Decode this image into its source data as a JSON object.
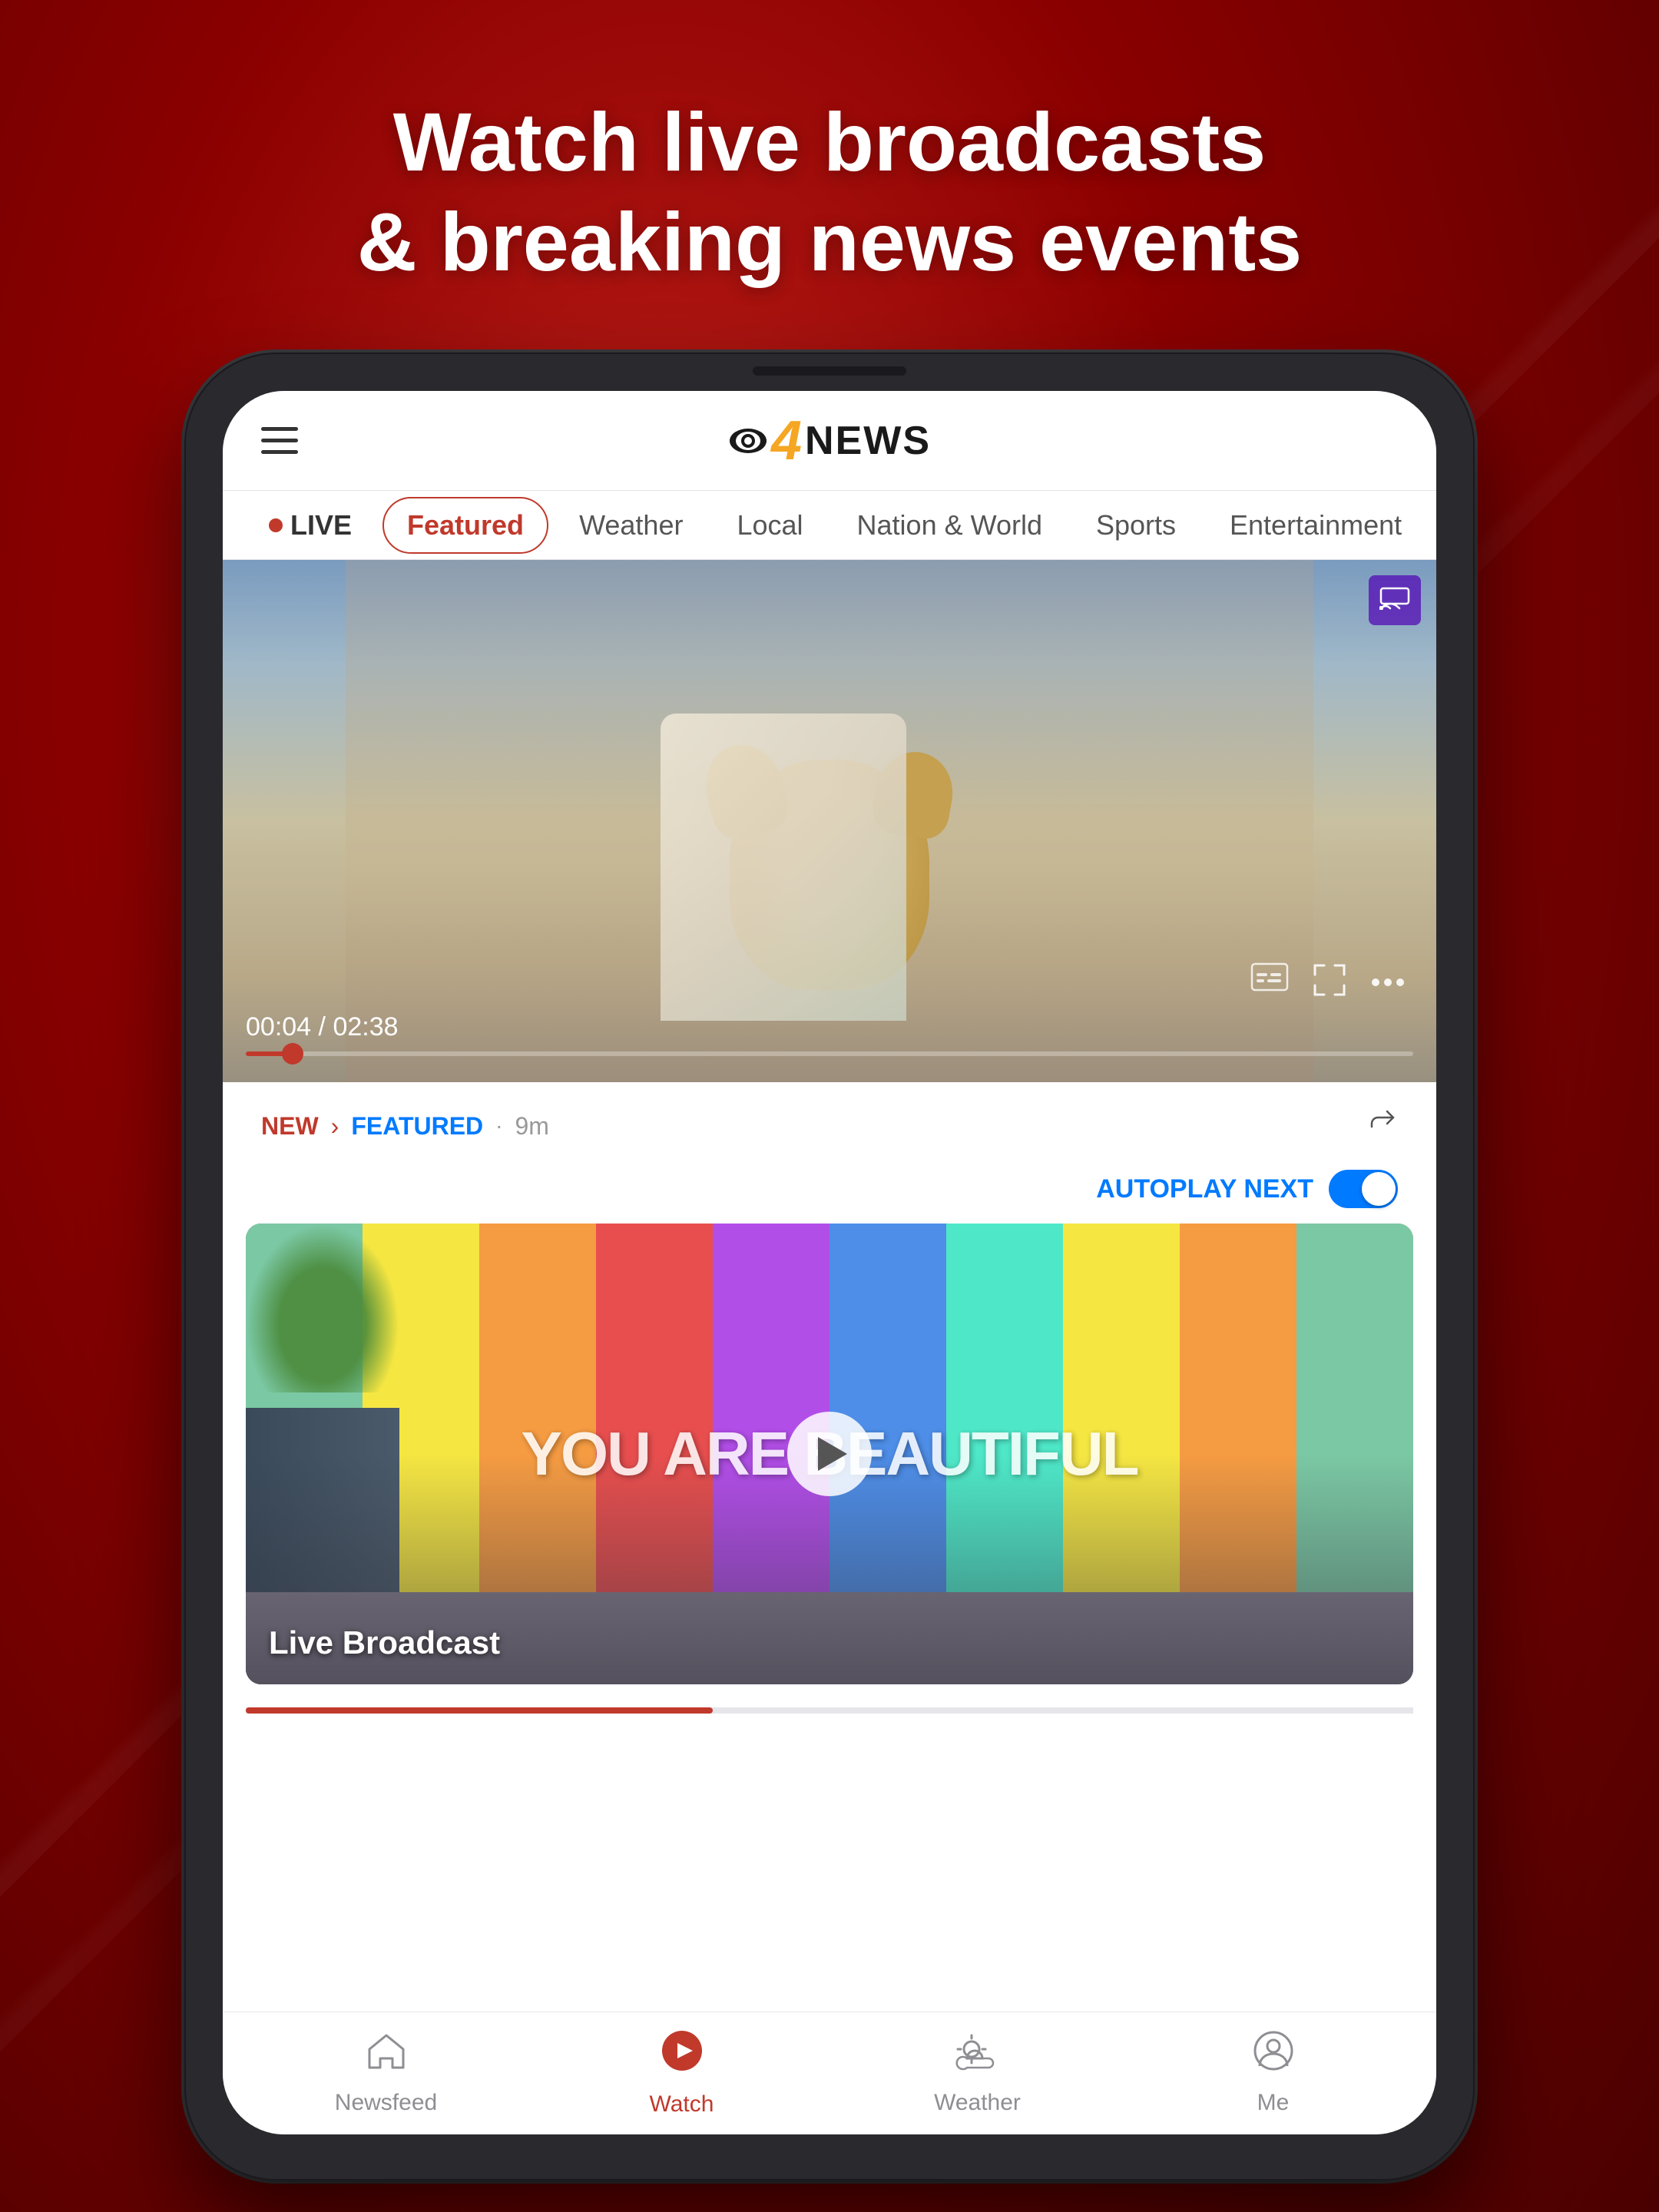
{
  "headline": {
    "line1": "Watch live broadcasts",
    "line2": "& breaking news events"
  },
  "app": {
    "logo": {
      "channel": "4",
      "name": "NEWS"
    }
  },
  "nav_tabs": {
    "items": [
      {
        "id": "live",
        "label": "LIVE",
        "active": false,
        "has_dot": true
      },
      {
        "id": "featured",
        "label": "Featured",
        "active": true
      },
      {
        "id": "weather",
        "label": "Weather",
        "active": false
      },
      {
        "id": "local",
        "label": "Local",
        "active": false
      },
      {
        "id": "nation-world",
        "label": "Nation & World",
        "active": false
      },
      {
        "id": "sports",
        "label": "Sports",
        "active": false
      },
      {
        "id": "entertainment",
        "label": "Entertainment",
        "active": false
      }
    ]
  },
  "video_player": {
    "time_current": "00:04",
    "time_total": "02:38",
    "progress_percent": 4
  },
  "article": {
    "badge_new": "NEW",
    "badge_featured": "FEATURED",
    "time_ago": "9m",
    "autoplay_label": "AUTOPLAY NEXT"
  },
  "next_video": {
    "title": "Live Broadcast",
    "mural_text": "YOU ARE BEAUTIFUL"
  },
  "bottom_nav": {
    "items": [
      {
        "id": "newsfeed",
        "label": "Newsfeed",
        "icon": "house",
        "active": false
      },
      {
        "id": "watch",
        "label": "Watch",
        "icon": "play-circle",
        "active": true
      },
      {
        "id": "weather",
        "label": "Weather",
        "icon": "cloud-sun",
        "active": false
      },
      {
        "id": "me",
        "label": "Me",
        "icon": "person-circle",
        "active": false
      }
    ]
  }
}
